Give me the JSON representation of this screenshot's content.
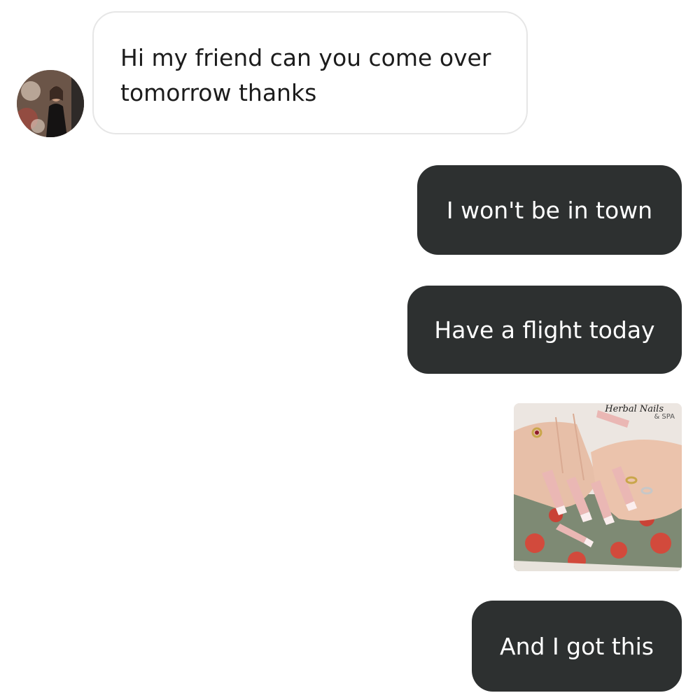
{
  "conversation": {
    "incoming": {
      "text": "Hi my friend can you come over tomorrow thanks"
    },
    "outgoing": [
      {
        "text": "I won't be in town"
      },
      {
        "text": "Have a flight today"
      },
      {
        "text": "And I got this"
      }
    ],
    "shared_image": {
      "watermark": "Herbal Nails",
      "watermark_sub": "& SPA"
    }
  },
  "colors": {
    "outgoing_bubble": "#2d3030",
    "incoming_bubble": "#ffffff",
    "incoming_border": "#e6e6e6"
  }
}
